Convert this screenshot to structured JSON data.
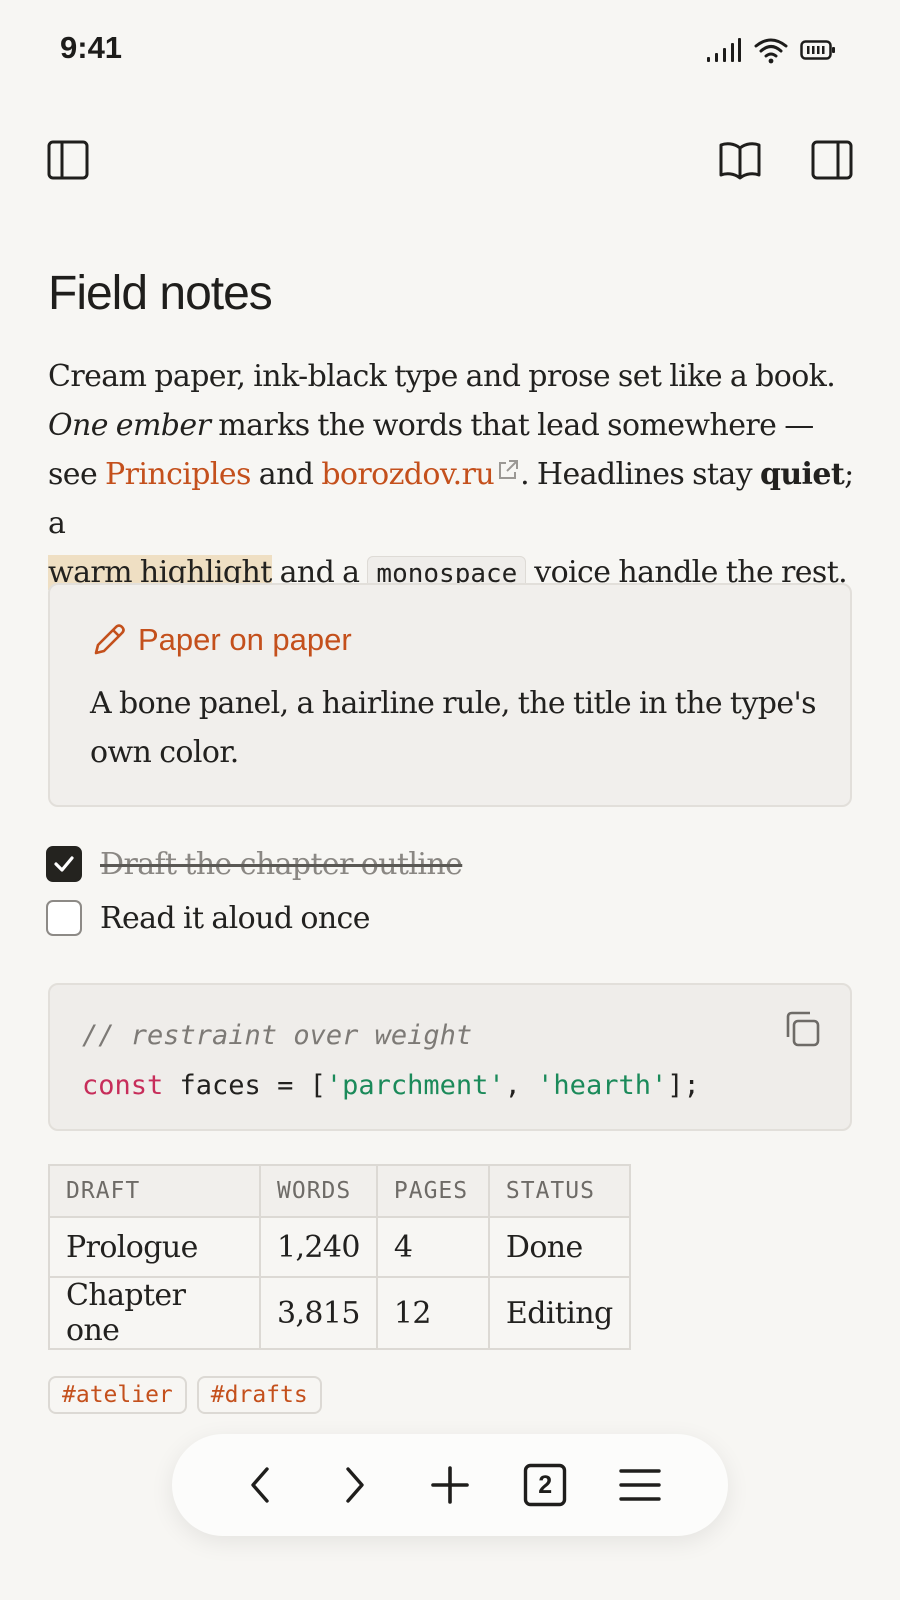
{
  "status_bar": {
    "time": "9:41"
  },
  "page": {
    "title": "Field notes",
    "prose": {
      "s1": "Cream paper, ink-black type and prose set like a book.",
      "em": "One ember",
      "s2": " marks the words that lead somewhere — see ",
      "link1": "Principles",
      "s3": " and ",
      "link2": "borozdov.ru",
      "s4": ". Headlines stay ",
      "bold": "quiet",
      "s5": "; a ",
      "highlight": "warm highlight",
      "s6": " and a ",
      "mono": "monospace",
      "s7": " voice handle the rest."
    }
  },
  "callout": {
    "title": "Paper on paper",
    "body": "A bone panel, a hairline rule, the title in the type's own color."
  },
  "tasks": [
    {
      "label": "Draft the chapter outline",
      "checked": true
    },
    {
      "label": "Read it aloud once",
      "checked": false
    }
  ],
  "code": {
    "comment": "// restraint over weight",
    "kw": "const",
    "plain1": " faces = [",
    "str1": "'parchment'",
    "plain2": ", ",
    "str2": "'hearth'",
    "plain3": "];"
  },
  "table": {
    "headers": [
      "DRAFT",
      "WORDS",
      "PAGES",
      "STATUS"
    ],
    "rows": [
      [
        "Prologue",
        "1,240",
        "4",
        "Done"
      ],
      [
        "Chapter one",
        "3,815",
        "12",
        "Editing"
      ]
    ]
  },
  "tags": [
    "#atelier",
    "#drafts"
  ],
  "bottom_nav": {
    "tab_count": "2"
  },
  "colors": {
    "background": "#f7f6f3",
    "accent": "#c4501c",
    "highlight": "#efdfc3",
    "code_keyword": "#c72d5a",
    "code_string": "#1b8a5a"
  },
  "icons": {
    "sidebar_left": "sidebar-left-icon",
    "reader": "book-open-icon",
    "sidebar_right": "sidebar-right-icon",
    "callout": "pencil-icon",
    "copy": "copy-icon",
    "back": "chevron-left-icon",
    "forward": "chevron-right-icon",
    "new": "plus-icon",
    "tabs": "tabs-icon",
    "menu": "menu-icon"
  }
}
